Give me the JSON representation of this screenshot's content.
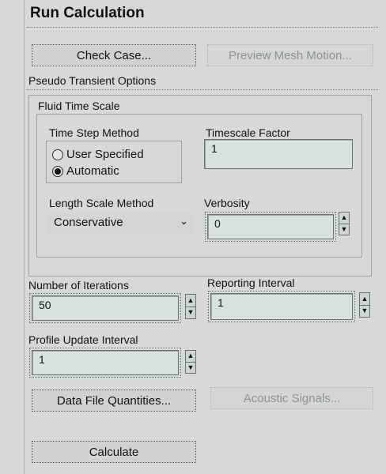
{
  "panel": {
    "title": "Run Calculation"
  },
  "buttons": {
    "check_case": "Check Case...",
    "preview_mesh_motion": "Preview Mesh Motion...",
    "data_file_quantities": "Data File Quantities...",
    "acoustic_signals": "Acoustic Signals...",
    "calculate": "Calculate"
  },
  "pseudo_transient": {
    "label": "Pseudo Transient Options",
    "fluid_time_scale": {
      "label": "Fluid Time Scale",
      "time_step_method": {
        "label": "Time Step Method",
        "options": [
          "User Specified",
          "Automatic"
        ],
        "selected": "Automatic"
      },
      "timescale_factor": {
        "label": "Timescale Factor",
        "value": "1"
      },
      "length_scale_method": {
        "label": "Length Scale Method",
        "value": "Conservative"
      },
      "verbosity": {
        "label": "Verbosity",
        "value": "0"
      }
    }
  },
  "iterations": {
    "number_label": "Number of Iterations",
    "number_value": "50",
    "reporting_label": "Reporting Interval",
    "reporting_value": "1",
    "profile_label": "Profile Update Interval",
    "profile_value": "1"
  },
  "icons": {
    "spin_up": "▲",
    "spin_down": "▼",
    "dropdown": "⌄"
  }
}
